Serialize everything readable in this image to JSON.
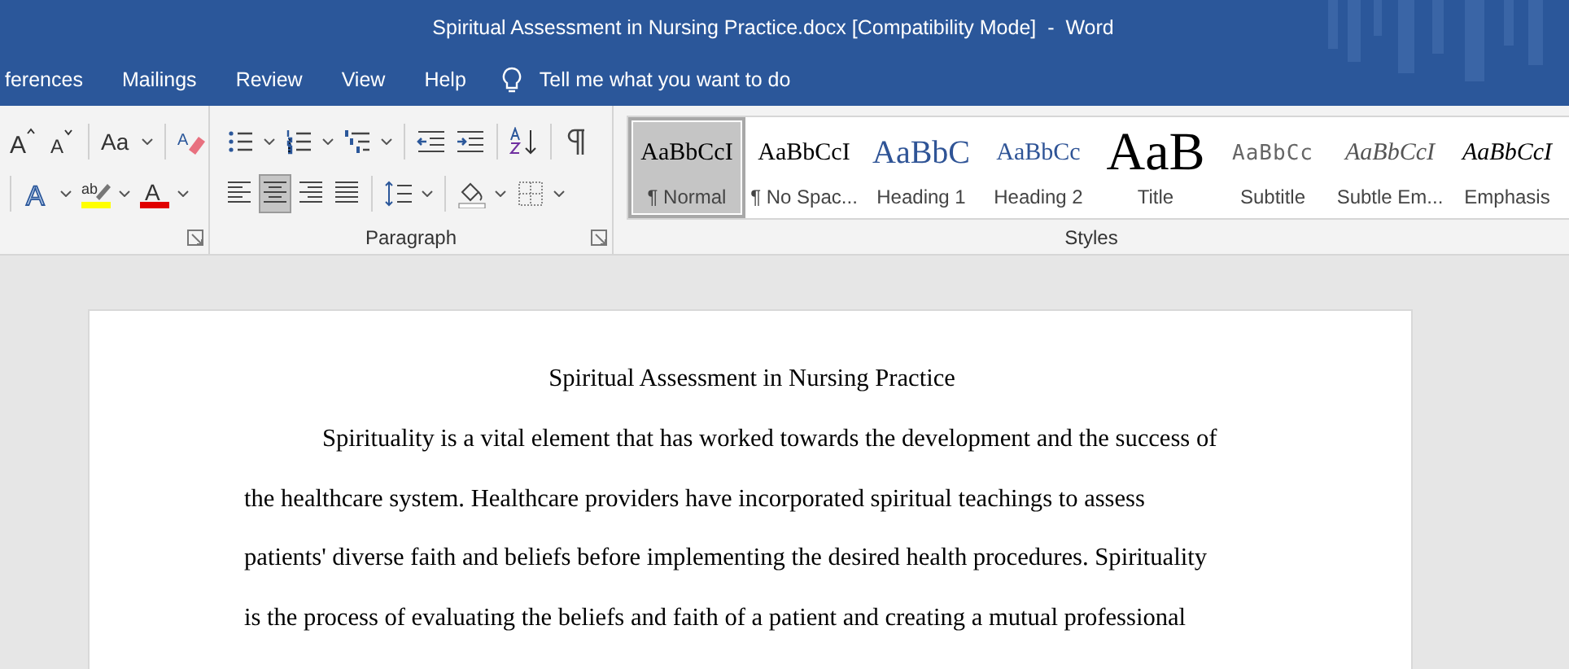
{
  "window": {
    "title": "Spiritual Assessment in Nursing Practice.docx [Compatibility Mode]  -  Word"
  },
  "ribbon_tabs": [
    {
      "label": "ferences",
      "selected": false
    },
    {
      "label": "Mailings",
      "selected": false
    },
    {
      "label": "Review",
      "selected": false
    },
    {
      "label": "View",
      "selected": false
    },
    {
      "label": "Help",
      "selected": false
    }
  ],
  "tell_me": {
    "placeholder": "Tell me what you want to do"
  },
  "font_group": {
    "tools": [
      {
        "kind": "grow_font",
        "glyph": "A"
      },
      {
        "kind": "shrink_font",
        "glyph": "A"
      },
      {
        "kind": "change_case",
        "glyph": "Aa"
      },
      {
        "kind": "clear_formatting",
        "glyph": "A"
      },
      {
        "kind": "text_effects",
        "glyph": "A"
      },
      {
        "kind": "highlight",
        "glyph": "ab"
      },
      {
        "kind": "font_color",
        "glyph": "A"
      }
    ]
  },
  "paragraph_group": {
    "label": "Paragraph",
    "alignments": [
      {
        "kind": "left",
        "selected": false
      },
      {
        "kind": "center",
        "selected": true
      },
      {
        "kind": "right",
        "selected": false
      },
      {
        "kind": "justify",
        "selected": false
      }
    ]
  },
  "styles_group": {
    "label": "Styles",
    "styles": [
      {
        "kind": "normal",
        "sample": "AaBbCcI",
        "label": "¶ Normal",
        "selected": true
      },
      {
        "kind": "normal",
        "sample": "AaBbCcI",
        "label": "¶ No Spac...",
        "selected": false
      },
      {
        "kind": "heading1",
        "sample": "AaBbC",
        "label": "Heading 1",
        "selected": false
      },
      {
        "kind": "heading2",
        "sample": "AaBbCc",
        "label": "Heading 2",
        "selected": false
      },
      {
        "kind": "title",
        "sample": "AaB",
        "label": "Title",
        "selected": false
      },
      {
        "kind": "subtitle",
        "sample": "AaBbCc",
        "label": "Subtitle",
        "selected": false
      },
      {
        "kind": "subtle",
        "sample": "AaBbCcI",
        "label": "Subtle Em...",
        "selected": false
      },
      {
        "kind": "emphasis",
        "sample": "AaBbCcI",
        "label": "Emphasis",
        "selected": false
      }
    ]
  },
  "document": {
    "title": "Spiritual Assessment in Nursing Practice",
    "paragraph_lines": [
      "Spirituality is a vital element that has worked towards the development and the success of",
      "the healthcare system. Healthcare providers have incorporated spiritual teachings to assess",
      "patients' diverse faith and beliefs before implementing the desired health procedures. Spirituality",
      "is the process of evaluating the beliefs and faith of a patient and creating a mutual professional"
    ]
  }
}
